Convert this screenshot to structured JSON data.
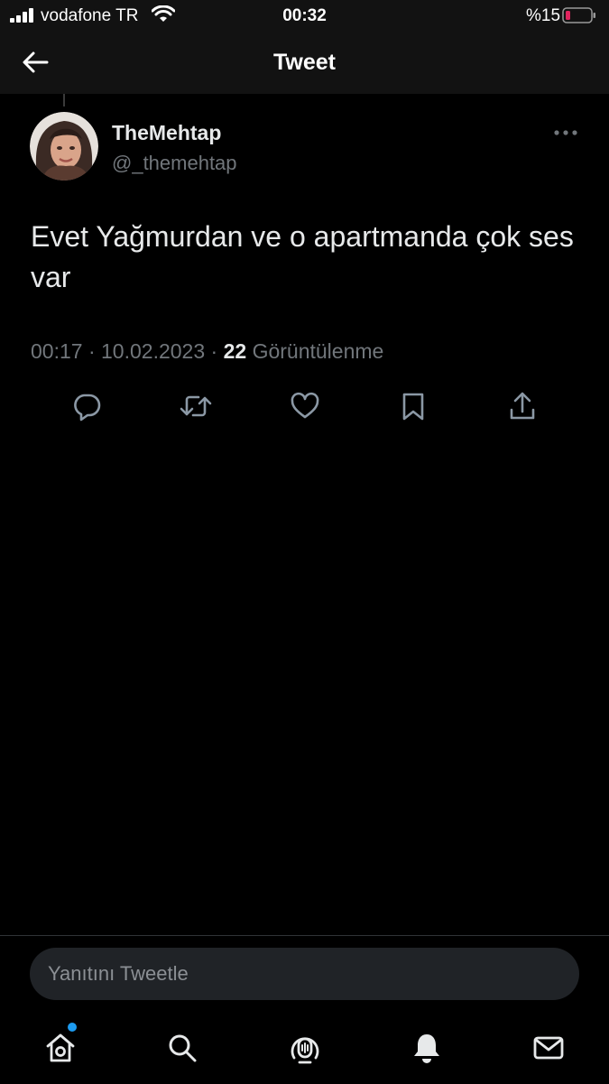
{
  "status_bar": {
    "carrier": "vodafone TR",
    "time": "00:32",
    "battery": "%15"
  },
  "header": {
    "title": "Tweet"
  },
  "tweet": {
    "display_name": "TheMehtap",
    "handle": "@_themehtap",
    "text": "Evet Yağmurdan ve o apartmanda çok ses var",
    "time": "00:17",
    "date": "10.02.2023",
    "views_count": "22",
    "views_label": "Görüntülenme"
  },
  "reply": {
    "placeholder": "Yanıtını Tweetle"
  },
  "icons": {
    "back": "back-arrow-icon",
    "more": "more-icon",
    "reply": "reply-icon",
    "retweet": "retweet-icon",
    "like": "heart-icon",
    "bookmark": "bookmark-icon",
    "share": "share-icon",
    "home": "home-icon",
    "search": "search-icon",
    "spaces": "spaces-icon",
    "notifications": "bell-icon",
    "messages": "mail-icon"
  },
  "colors": {
    "background": "#000000",
    "accent": "#1d9bf0",
    "secondary_text": "#71767b",
    "battery_low": "#e0245e"
  }
}
